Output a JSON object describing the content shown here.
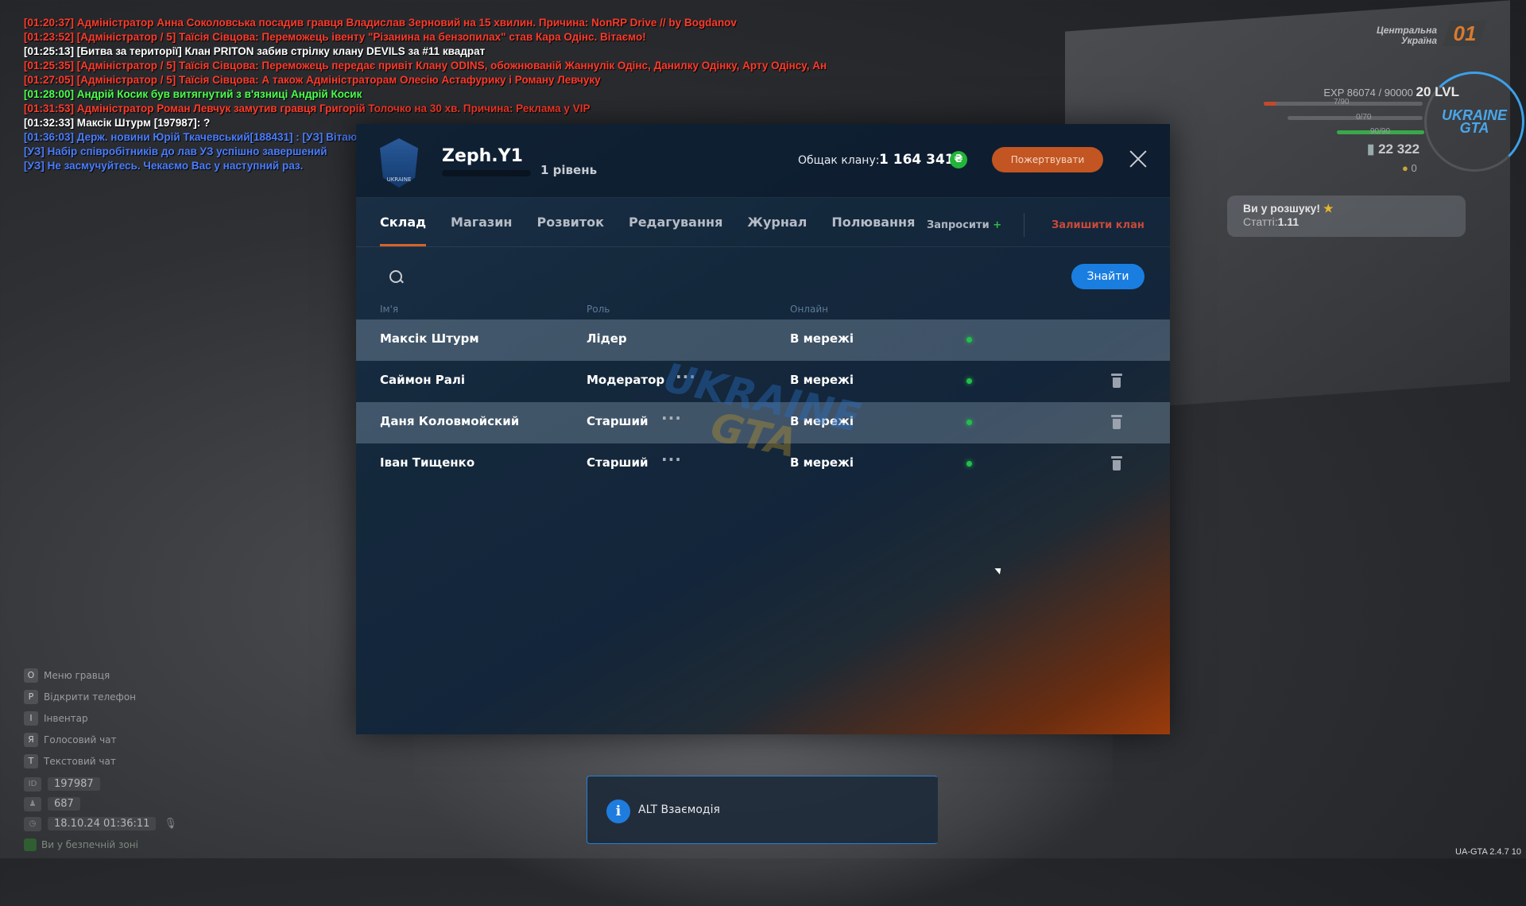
{
  "chat": [
    {
      "color": "#ff3a2a",
      "text": "[01:20:37] Адміністратор Анна Соколовська посадив гравця Владислав Зерновий на 15 хвилин. Причина: NonRP Drive // by Bogdanov"
    },
    {
      "color": "#ff3a2a",
      "text": "[01:23:52] [Адміністратор / 5] Таїсія Сівцова: Переможець івенту \"Різанина на бензопилах\" став Кара Одінс. Вітаємо!"
    },
    {
      "color": "#ffffff",
      "text": "[01:25:13] [Битва за території] Клан PRITON забив стрілку клану DEVILS за #11 квадрат"
    },
    {
      "color": "#ff3a2a",
      "text": "[01:25:35] [Адміністратор / 5] Таїсія Сівцова: Переможець передає привіт Клану ODINS, обожнюваній Жаннулік Одінс, Данилку Одінку, Арту Одінсу, Андре Танну і всім гравцям"
    },
    {
      "color": "#ff3a2a",
      "text": "[01:27:05] [Адміністратор / 5] Таїсія Сівцова: А також Адміністраторам Олесію Астафурику і Роману Левчуку"
    },
    {
      "color": "#4cff4c",
      "text": "[01:28:00] Андрій Косик був витягнутий з в'язниці Андрій Косик"
    },
    {
      "color": "#ff3a2a",
      "text": "[01:31:53] Адміністратор Роман Левчук замутив гравця Григорій Толочко на 30 хв. Причина: Реклама у VIP"
    },
    {
      "color": "#ffffff",
      "text": "[01:32:33] Максік Штурм [197987]: ?"
    },
    {
      "color": "#4a7dff",
      "text": "[01:36:03] Держ. новини Юрій Ткачевський[188431] : [УЗ] Вітаю Шановні Громадяни Центральної України!"
    },
    {
      "color": "#4a7dff",
      "text": "[УЗ] Набір співробітників до лав УЗ успішно завершений"
    },
    {
      "color": "#4a7dff",
      "text": "[УЗ] Не засмучуйтесь. Чекаємо Вас у наступний раз."
    }
  ],
  "hints": [
    {
      "key": "O",
      "label": "Меню гравця"
    },
    {
      "key": "P",
      "label": "Відкрити телефон"
    },
    {
      "key": "I",
      "label": "Інвентар"
    },
    {
      "key": "Я",
      "label": "Голосовий чат"
    },
    {
      "key": "T",
      "label": "Текстовий чат"
    }
  ],
  "player": {
    "id_label": "ID",
    "id": "197987",
    "online": "687",
    "datetime": "18.10.24 01:36:11",
    "safe_zone": "Ви у безпечній зоні"
  },
  "hud": {
    "region": "Центральна Україна",
    "region_num": "01",
    "exp": "EXP 86074 / 90000",
    "level": "20 LVL",
    "bar1": "7/90",
    "bar1_frac": 0.08,
    "bar2": "0/70",
    "bar2_frac": 0.0,
    "bar3": "90/90",
    "bar3_frac": 1.0,
    "money": "22 322",
    "coins": "0",
    "emblem": "UKRAINE GTA"
  },
  "wanted": {
    "title": "Ви у розшуку!",
    "stat_label": "Статті:",
    "stat_value": "1.11"
  },
  "clan": {
    "logo_text": "UKRAINE",
    "name": "Zeph.Y1",
    "level": "1 рівень",
    "treasury_label": "Общак клану:",
    "treasury_value": "1 164 341",
    "currency_icon": "₴",
    "donate": "Пожертвувати",
    "tabs": [
      "Склад",
      "Магазин",
      "Розвиток",
      "Редагування",
      "Журнал",
      "Полювання"
    ],
    "invite": "Запросити",
    "leave": "Залишити клан",
    "search_placeholder": "",
    "find": "Знайти",
    "columns": {
      "name": "Ім'я",
      "role": "Роль",
      "online": "Онлайн"
    },
    "members": [
      {
        "name": "Максік Штурм",
        "role": "Лідер",
        "status": "В мережі"
      },
      {
        "name": "Саймон Ралі",
        "role": "Модератор",
        "status": "В мережі"
      },
      {
        "name": "Даня Коловмойский",
        "role": "Старший",
        "status": "В мережі"
      },
      {
        "name": "Іван Тищенко",
        "role": "Старший",
        "status": "В мережі"
      }
    ],
    "watermark_top": "UKRAINE",
    "watermark_bottom": "GTA"
  },
  "notification": {
    "text": "ALT Взаємодія"
  },
  "version": "UA-GTA 2.4.7   10"
}
